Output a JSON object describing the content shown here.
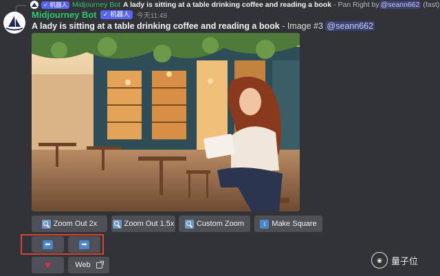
{
  "reply": {
    "tag": "✓ 机器人",
    "bot_name": "Midjourney Bot",
    "prompt": "A lady is sitting at a table drinking coffee and reading a book",
    "action": " - Pan Right by",
    "mention": "@seann662",
    "speed": "(fast)"
  },
  "message": {
    "author": "Midjourney Bot",
    "tag": "✓ 机器人",
    "time": "今天11:48",
    "prompt": "A lady is sitting at a table drinking coffee and reading a book",
    "image_label": " - Image #3 ",
    "mention": "@seann662"
  },
  "buttons": {
    "zoom_out_2x": "Zoom Out 2x",
    "zoom_out_15x": "Zoom Out 1.5x",
    "custom_zoom": "Custom Zoom",
    "make_square": "Make Square",
    "pan_left": "⬅",
    "pan_right": "➡",
    "heart": "♥",
    "web": "Web"
  },
  "watermark": {
    "text": "量子位",
    "icon": "量子位"
  },
  "icons": {
    "zoom": "magnifier-icon",
    "square": "expand-icon",
    "external": "external-link-icon",
    "image": "image-icon"
  },
  "colors": {
    "background": "#313338",
    "bot_name": "#2dc770",
    "app_tag": "#5865f2",
    "button": "#4e5058",
    "highlight": "#d9432f"
  }
}
